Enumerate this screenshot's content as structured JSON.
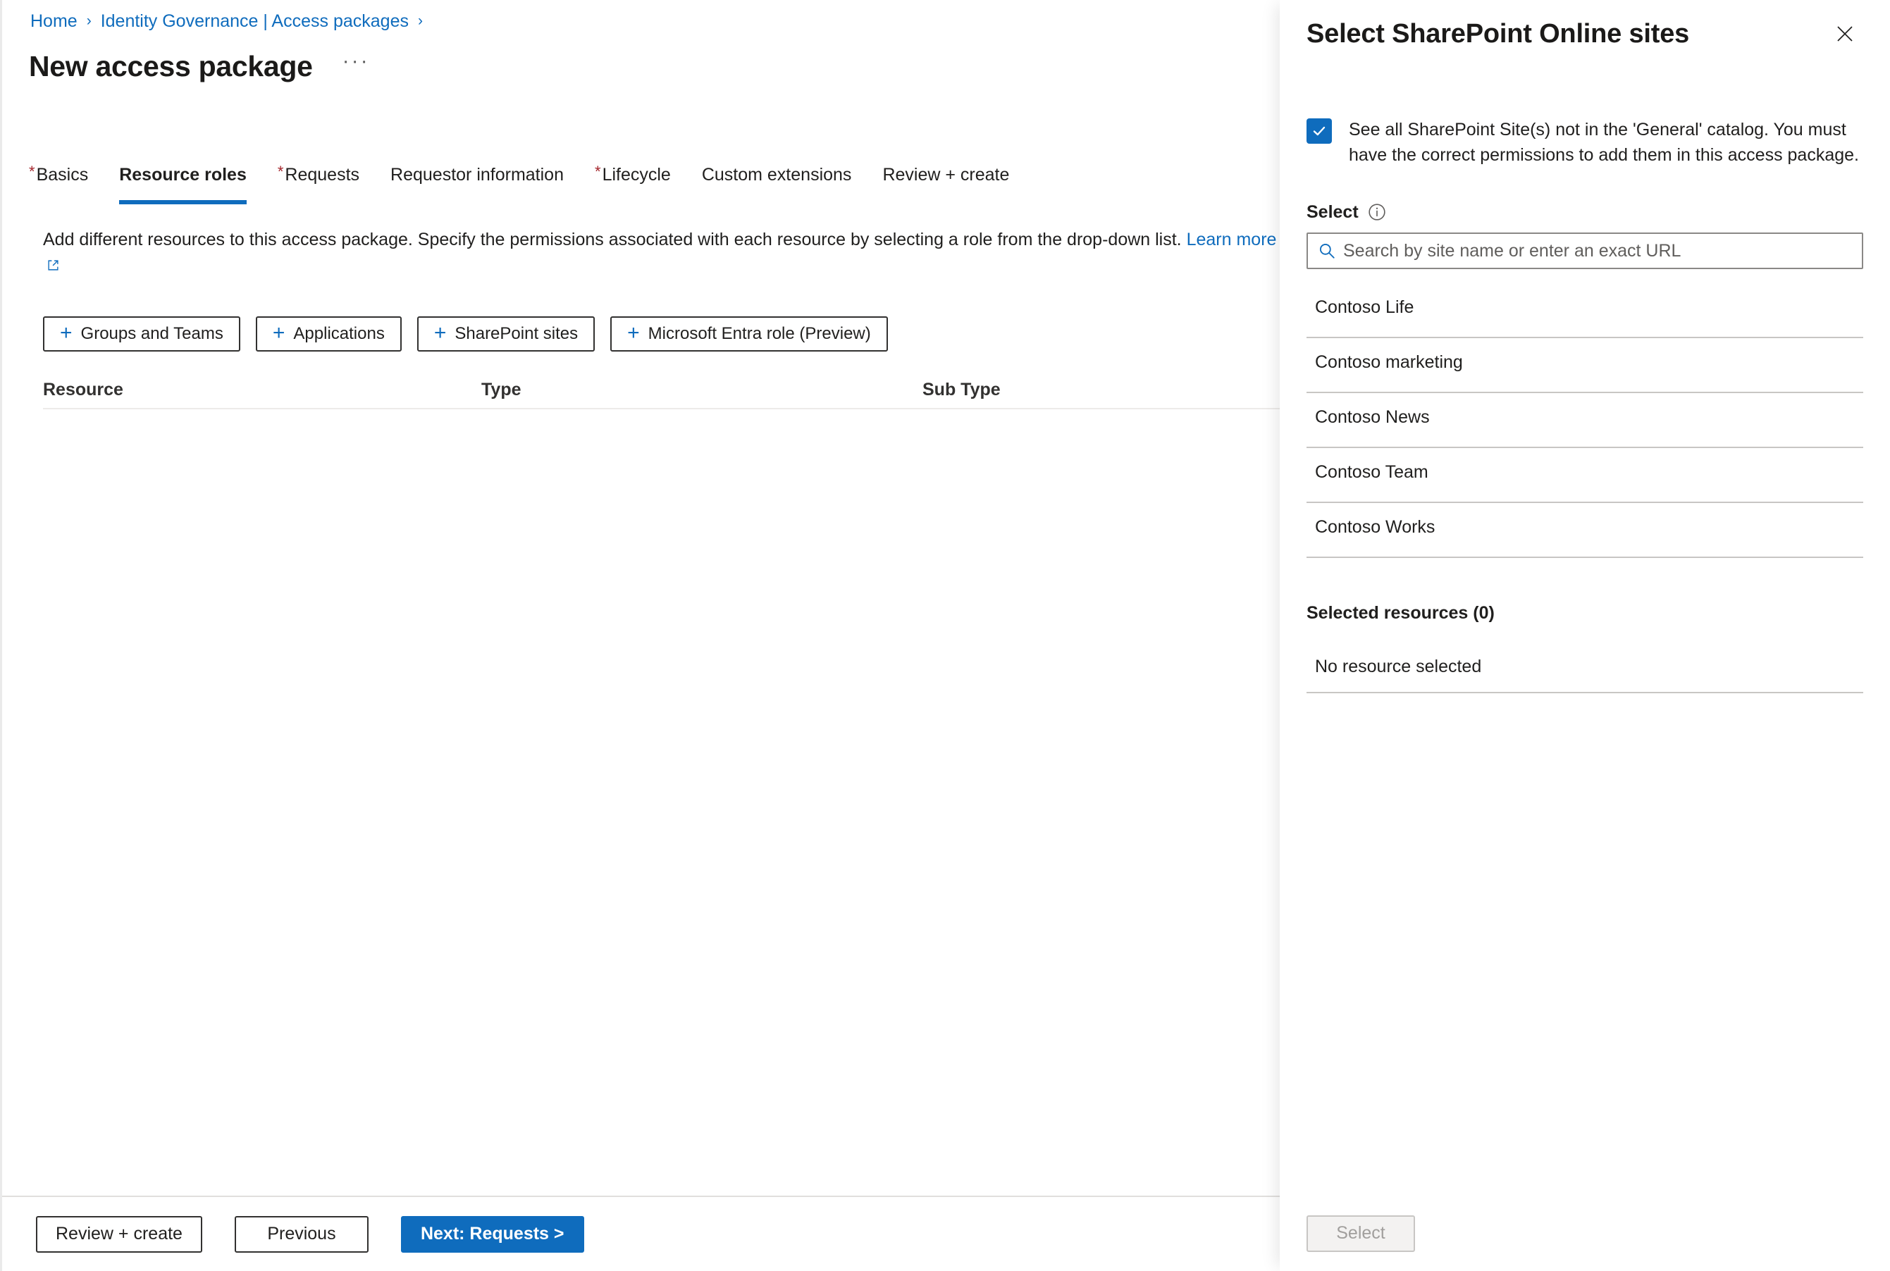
{
  "breadcrumb": {
    "items": [
      {
        "label": "Home"
      },
      {
        "label": "Identity Governance | Access packages"
      }
    ],
    "separator": "›"
  },
  "header": {
    "title": "New access package",
    "ellipsis": "···"
  },
  "tabs": [
    {
      "label": "Basics",
      "required": true,
      "active": false
    },
    {
      "label": "Resource roles",
      "required": false,
      "active": true
    },
    {
      "label": "Requests",
      "required": true,
      "active": false
    },
    {
      "label": "Requestor information",
      "required": false,
      "active": false
    },
    {
      "label": "Lifecycle",
      "required": true,
      "active": false
    },
    {
      "label": "Custom extensions",
      "required": false,
      "active": false
    },
    {
      "label": "Review + create",
      "required": false,
      "active": false
    }
  ],
  "description": {
    "text": "Add different resources to this access package. Specify the permissions associated with each resource by selecting a role from the drop-down list.",
    "link_label": "Learn more"
  },
  "add_buttons": [
    {
      "label": "Groups and Teams",
      "plus": "+"
    },
    {
      "label": "Applications",
      "plus": "+"
    },
    {
      "label": "SharePoint sites",
      "plus": "+"
    },
    {
      "label": "Microsoft Entra role (Preview)",
      "plus": "+"
    }
  ],
  "resource_table": {
    "columns": [
      "Resource",
      "Type",
      "Sub Type"
    ],
    "rows": []
  },
  "footer": {
    "review_create": "Review + create",
    "previous": "Previous",
    "next": "Next: Requests >"
  },
  "pane": {
    "title": "Select SharePoint Online sites",
    "close_label": "Close",
    "checkbox": {
      "checked": true,
      "label": "See all SharePoint Site(s) not in the 'General' catalog. You must have the correct permissions to add them in this access package."
    },
    "select_label": "Select",
    "search": {
      "placeholder": "Search by site name or enter an exact URL",
      "value": ""
    },
    "sites": [
      {
        "name": "Contoso Life",
        "url": ""
      },
      {
        "name": "Contoso marketing",
        "url": ""
      },
      {
        "name": "Contoso News",
        "url": ""
      },
      {
        "name": "Contoso Team",
        "url": ""
      },
      {
        "name": "Contoso Works",
        "url": ""
      }
    ],
    "selected_resources": {
      "heading": "Selected resources (0)",
      "empty_text": "No resource selected"
    },
    "select_button": "Select"
  },
  "colors": {
    "accent": "#0f6cbd",
    "required_star": "#a4262c",
    "text": "#201f1e",
    "divider": "#c8c6c4"
  }
}
